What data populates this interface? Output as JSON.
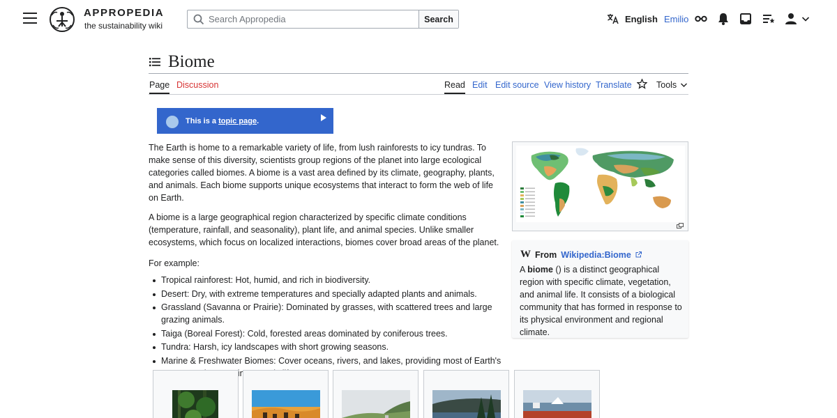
{
  "header": {
    "site_name": "APPROPEDIA",
    "tagline": "the sustainability wiki",
    "search": {
      "placeholder": "Search Appropedia",
      "button_label": "Search"
    },
    "language_label": "English",
    "username": "Emilio",
    "icons": [
      "menu-icon",
      "translate-icon",
      "watchlist-icon",
      "bell-icon",
      "inbox-icon",
      "contributions-icon",
      "user-icon",
      "chevron-down-icon"
    ]
  },
  "page": {
    "title": "Biome",
    "tabs": {
      "page": "Page",
      "discussion": "Discussion",
      "read": "Read",
      "edit": "Edit",
      "edit_source": "Edit source",
      "view_history": "View history",
      "translate": "Translate",
      "tools": "Tools"
    }
  },
  "banner": {
    "text_prefix": "This is a ",
    "link_text": "topic page",
    "text_suffix": "."
  },
  "content": {
    "paragraphs": [
      "The Earth is home to a remarkable variety of life, from lush rainforests to icy tundras. To make sense of this diversity, scientists group regions of the planet into large ecological categories called biomes. A biome is a vast area defined by its climate, geography, plants, and animals. Each biome supports unique ecosystems that interact to form the web of life on Earth.",
      "A biome is a large geographical region characterized by specific climate conditions (temperature, rainfall, and seasonality), plant life, and animal species. Unlike smaller ecosystems, which focus on localized interactions, biomes cover broad areas of the planet."
    ],
    "examples_intro": "For example:",
    "examples": [
      "Tropical rainforest: Hot, humid, and rich in biodiversity.",
      "Desert: Dry, with extreme temperatures and specially adapted plants and animals.",
      "Grassland (Savanna or Prairie): Dominated by grasses, with scattered trees and large grazing animals.",
      "Taiga (Boreal Forest): Cold, forested areas dominated by coniferous trees.",
      "Tundra: Harsh, icy landscapes with short growing seasons.",
      "Marine & Freshwater Biomes: Cover oceans, rivers, and lakes, providing most of Earth's oxygen and supporting aquatic life."
    ]
  },
  "wikipedia_box": {
    "from_label": "From",
    "link_text": "Wikipedia:Biome",
    "text_a": "A ",
    "text_bold": "biome",
    "text_rest": " () is a distinct geographical region with specific climate, vegetation, and animal life. It consists of a biological community that has formed in response to its physical environment and regional climate."
  },
  "colors": {
    "link": "#3366cc",
    "red_link": "#d73333",
    "banner": "#3366cc",
    "text": "#202122",
    "border": "#a2a9b1"
  }
}
